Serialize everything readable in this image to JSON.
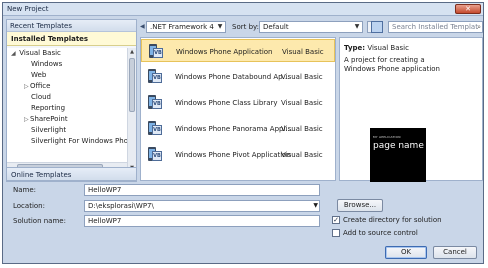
{
  "window": {
    "title": "New Project",
    "close_glyph": "✕"
  },
  "left_pane": {
    "recent_header": "Recent Templates",
    "installed_header": "Installed Templates",
    "tree": [
      {
        "label": "Visual Basic",
        "level": "root",
        "expanded": true
      },
      {
        "label": "Windows",
        "level": "child"
      },
      {
        "label": "Web",
        "level": "child"
      },
      {
        "label": "Office",
        "level": "expandable"
      },
      {
        "label": "Cloud",
        "level": "child"
      },
      {
        "label": "Reporting",
        "level": "child"
      },
      {
        "label": "SharePoint",
        "level": "expandable"
      },
      {
        "label": "Silverlight",
        "level": "child"
      },
      {
        "label": "Silverlight For Windows Phone",
        "level": "child"
      }
    ],
    "online_header": "Online Templates"
  },
  "toolbar": {
    "framework": ".NET Framework 4",
    "sort_label": "Sort by:",
    "sort_value": "Default",
    "search_placeholder": "Search Installed Templat"
  },
  "templates": [
    {
      "name": "Windows Phone Application",
      "lang": "Visual Basic",
      "selected": true
    },
    {
      "name": "Windows Phone Databound Ap...",
      "lang": "Visual Basic",
      "selected": false
    },
    {
      "name": "Windows Phone Class Library",
      "lang": "Visual Basic",
      "selected": false
    },
    {
      "name": "Windows Phone Panorama Appl...",
      "lang": "Visual Basic",
      "selected": false
    },
    {
      "name": "Windows Phone Pivot Application",
      "lang": "Visual Basic",
      "selected": false
    }
  ],
  "description": {
    "type_label": "Type:",
    "type_value": "Visual Basic",
    "text": "A project for creating a Windows Phone application",
    "preview_app_title": "MY APPLICATION",
    "preview_page_title": "page name"
  },
  "form": {
    "name_label": "Name:",
    "name_value": "HelloWP7",
    "location_label": "Location:",
    "location_value": "D:\\eksplorasi\\WP7\\",
    "solution_label": "Solution name:",
    "solution_value": "HelloWP7",
    "browse_label": "Browse...",
    "create_dir_label": "Create directory for solution",
    "create_dir_checked": true,
    "source_control_label": "Add to source control",
    "source_control_checked": false,
    "ok_label": "OK",
    "cancel_label": "Cancel"
  },
  "colors": {
    "accent": "#3d6bb2",
    "selection": "#fde9ad",
    "chrome": "#c9d6e8"
  }
}
